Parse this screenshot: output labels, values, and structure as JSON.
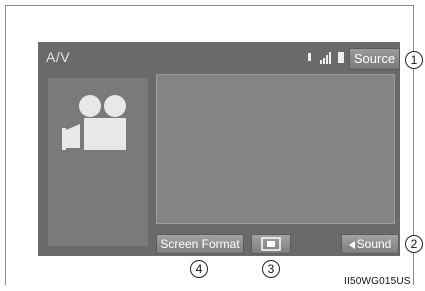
{
  "screen": {
    "title": "A/V",
    "source_label": "Source",
    "status_icons": [
      "bluetooth-icon",
      "signal-strength-icon",
      "battery-icon"
    ]
  },
  "side_panel": {
    "icon": "video-camera-icon"
  },
  "bottom_bar": {
    "screen_format_label": "Screen Format",
    "picture_adjust_icon": "picture-adjust-icon",
    "sound_label": "Sound",
    "sound_icon": "speaker-icon"
  },
  "callouts": {
    "c1": "1",
    "c2": "2",
    "c3": "3",
    "c4": "4"
  },
  "figure_code": "II50WG015US",
  "colors": {
    "screen_bg": "#6a6a6a",
    "panel_bg": "#7a7a7a",
    "button_face": "#8e8e8e",
    "text": "#ffffff"
  }
}
